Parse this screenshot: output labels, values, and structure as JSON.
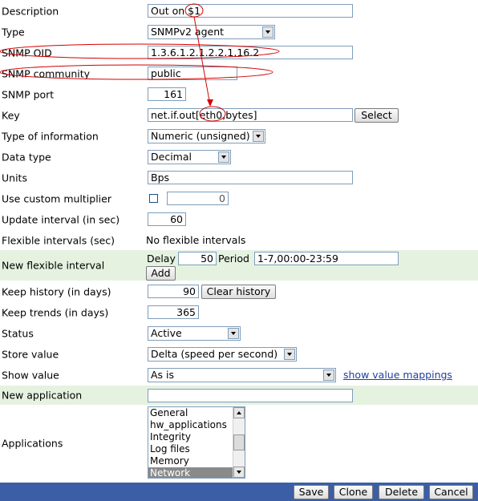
{
  "fields": {
    "description": {
      "label": "Description",
      "value": "Out on $1"
    },
    "type": {
      "label": "Type",
      "value": "SNMPv2 agent"
    },
    "snmp_oid": {
      "label": "SNMP OID",
      "value": "1.3.6.1.2.1.2.2.1.16.2"
    },
    "snmp_community": {
      "label": "SNMP community",
      "value": "public"
    },
    "snmp_port": {
      "label": "SNMP port",
      "value": "161"
    },
    "key": {
      "label": "Key",
      "value": "net.if.out[eth0,bytes]",
      "select_label": "Select"
    },
    "type_of_information": {
      "label": "Type of information",
      "value": "Numeric (unsigned)"
    },
    "data_type": {
      "label": "Data type",
      "value": "Decimal"
    },
    "units": {
      "label": "Units",
      "value": "Bps"
    },
    "custom_multiplier": {
      "label": "Use custom multiplier",
      "value": "0"
    },
    "update_interval": {
      "label": "Update interval (in sec)",
      "value": "60"
    },
    "flexible_intervals": {
      "label": "Flexible intervals (sec)",
      "value": "No flexible intervals"
    },
    "new_flexible_interval": {
      "label": "New flexible interval",
      "delay_label": "Delay",
      "delay_value": "50",
      "period_label": "Period",
      "period_value": "1-7,00:00-23:59",
      "add_label": "Add"
    },
    "keep_history": {
      "label": "Keep history (in days)",
      "value": "90",
      "clear_label": "Clear history"
    },
    "keep_trends": {
      "label": "Keep trends (in days)",
      "value": "365"
    },
    "status": {
      "label": "Status",
      "value": "Active"
    },
    "store_value": {
      "label": "Store value",
      "value": "Delta (speed per second)"
    },
    "show_value": {
      "label": "Show value",
      "value": "As is",
      "mappings_link": "show value mappings"
    },
    "new_application": {
      "label": "New application",
      "value": ""
    },
    "applications": {
      "label": "Applications",
      "options": [
        "General",
        "hw_applications",
        "Integrity",
        "Log files",
        "Memory",
        "Network"
      ],
      "selected": "Network"
    }
  },
  "footer": {
    "save": "Save",
    "clone": "Clone",
    "delete": "Delete",
    "cancel": "Cancel"
  },
  "colors": {
    "annotation": "#d40000",
    "footer": "#3b5ea6",
    "highlight_row": "#e5f2e0",
    "link": "#1f3fa0"
  }
}
